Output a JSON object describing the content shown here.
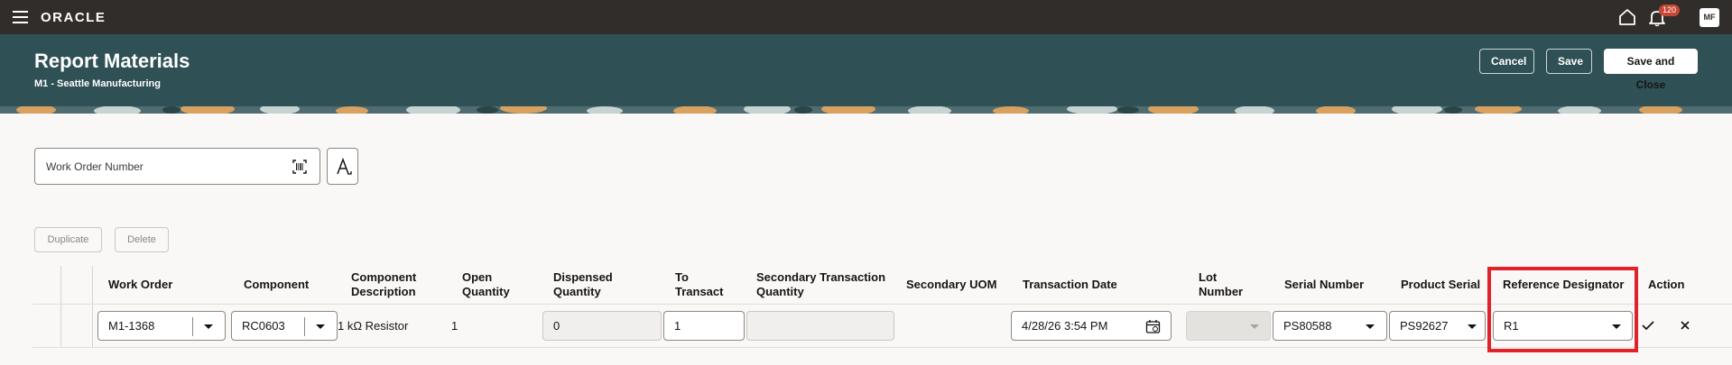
{
  "topbar": {
    "logo": "ORACLE",
    "notifications_count": "120",
    "avatar_initials": "MF"
  },
  "header": {
    "title": "Report Materials",
    "subtitle": "M1 - Seattle Manufacturing",
    "cancel_label": "Cancel",
    "save_label": "Save",
    "save_close_label": "Save and Close"
  },
  "search": {
    "placeholder": "Work Order Number"
  },
  "toolbar": {
    "duplicate_label": "Duplicate",
    "delete_label": "Delete"
  },
  "table": {
    "columns": {
      "work_order": "Work Order",
      "component": "Component",
      "component_description_1": "Component",
      "component_description_2": "Description",
      "open_quantity_1": "Open",
      "open_quantity_2": "Quantity",
      "dispensed_quantity_1": "Dispensed",
      "dispensed_quantity_2": "Quantity",
      "to_transact_1": "To",
      "to_transact_2": "Transact",
      "secondary_transaction_quantity_1": "Secondary Transaction",
      "secondary_transaction_quantity_2": "Quantity",
      "secondary_uom": "Secondary UOM",
      "transaction_date": "Transaction Date",
      "lot_number_1": "Lot",
      "lot_number_2": "Number",
      "serial_number": "Serial Number",
      "product_serial": "Product Serial",
      "reference_designator": "Reference Designator",
      "action": "Action"
    },
    "row": {
      "work_order": "M1-1368",
      "component": "RC0603",
      "component_description": "1 kΩ Resistor",
      "open_quantity": "1",
      "dispensed_quantity": "0",
      "to_transact": "1",
      "secondary_transaction_quantity": "",
      "secondary_uom": "",
      "transaction_date": "4/28/26 3:54 PM",
      "lot_number": "",
      "serial_number": "PS80588",
      "product_serial": "PS92627",
      "reference_designator": "R1"
    }
  },
  "colors": {
    "topbar": "#312d2a",
    "header": "#2f5054",
    "highlight": "#e0222a",
    "badge": "#c74634"
  }
}
